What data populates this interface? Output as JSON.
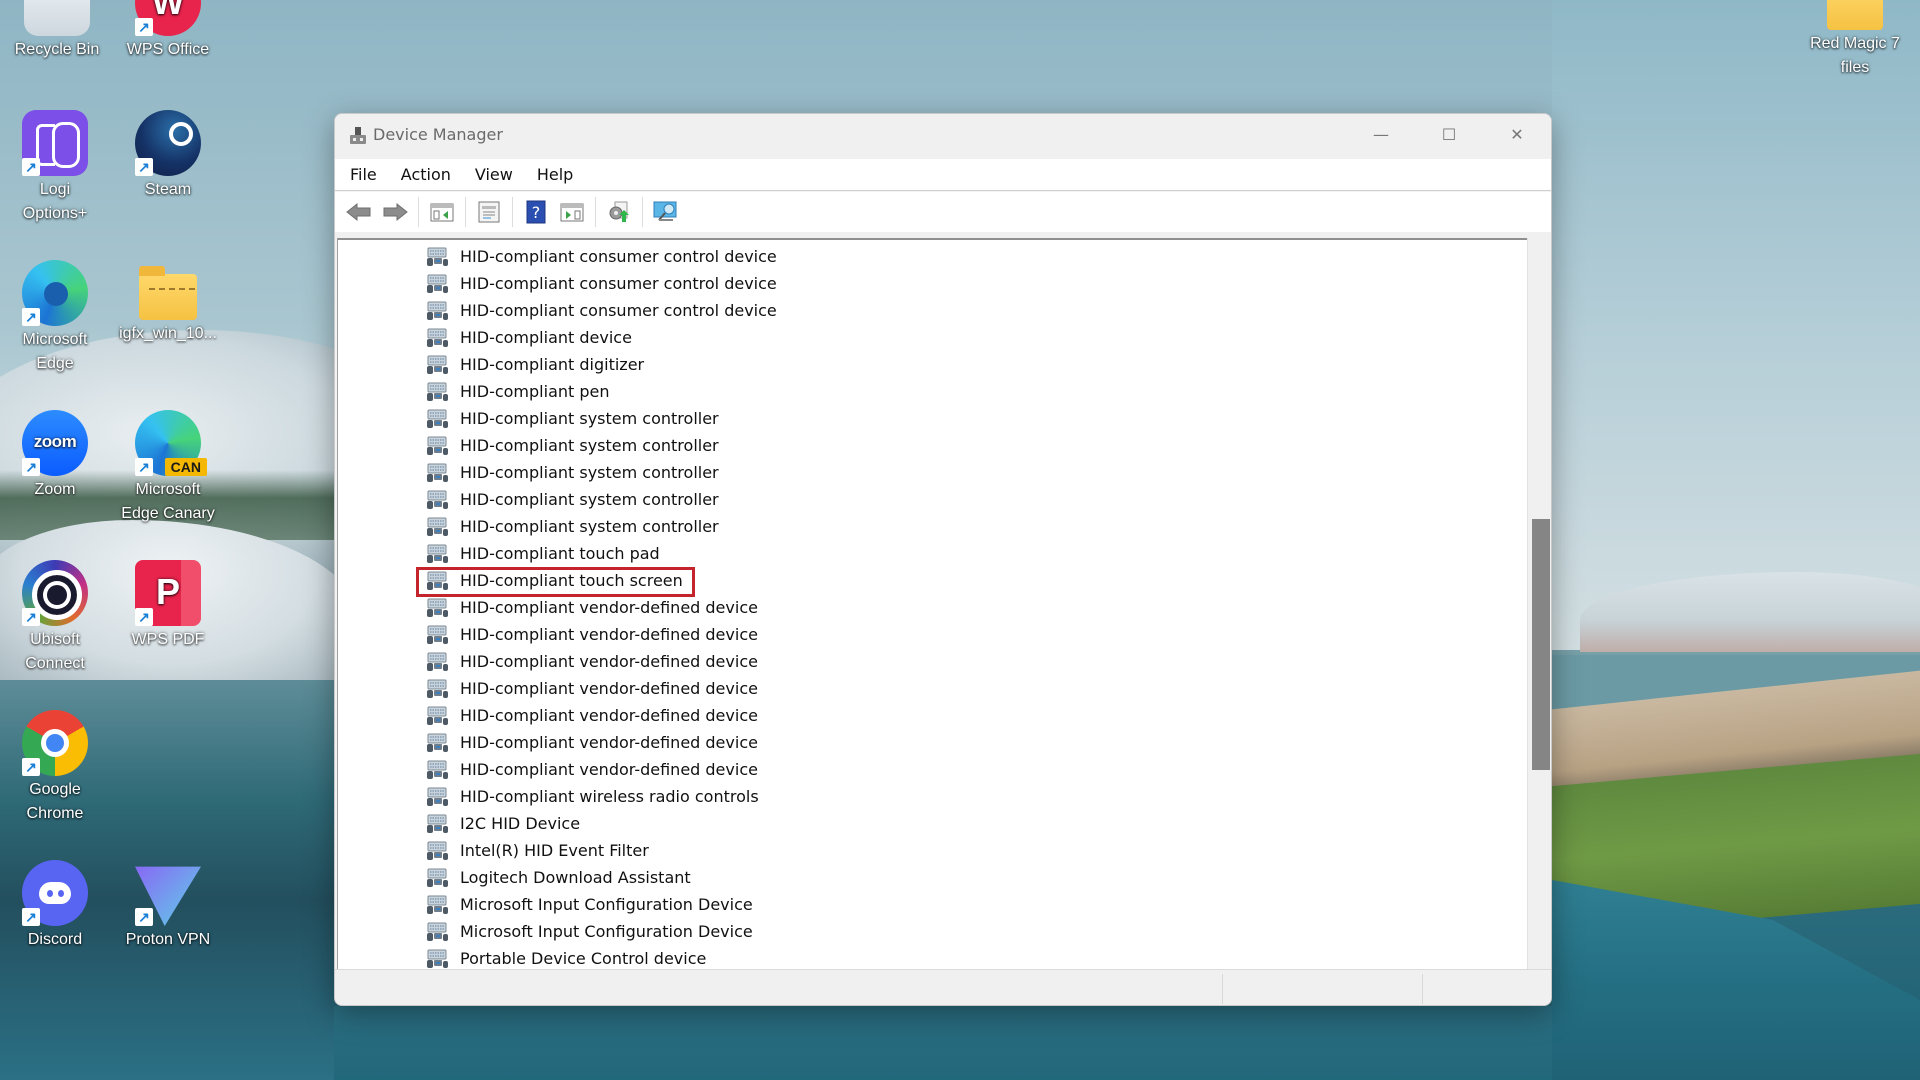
{
  "desktop": {
    "icons": [
      {
        "label": "Recycle Bin",
        "icon": "recycle-bin-icon"
      },
      {
        "label": "WPS Office",
        "icon": "wps-office-icon"
      },
      {
        "label": "Logi Options+",
        "icon": "logi-options-icon"
      },
      {
        "label": "Steam",
        "icon": "steam-icon"
      },
      {
        "label": "Microsoft Edge",
        "icon": "edge-icon"
      },
      {
        "label": "igfx_win_10...",
        "icon": "zip-folder-icon"
      },
      {
        "label": "Zoom",
        "icon": "zoom-icon",
        "glyph": "zoom"
      },
      {
        "label": "Microsoft Edge Canary",
        "icon": "edge-canary-icon",
        "badge": "CAN"
      },
      {
        "label": "Ubisoft Connect",
        "icon": "ubisoft-icon"
      },
      {
        "label": "WPS PDF",
        "icon": "wps-pdf-icon"
      },
      {
        "label": "Google Chrome",
        "icon": "chrome-icon"
      },
      {
        "label": "Discord",
        "icon": "discord-icon"
      },
      {
        "label": "Proton VPN",
        "icon": "proton-vpn-icon"
      },
      {
        "label": "Red Magic 7 files",
        "icon": "folder-icon"
      }
    ],
    "shortcut_glyph": "↗"
  },
  "window": {
    "title": "Device Manager",
    "controls": {
      "minimize": "—",
      "maximize": "☐",
      "close": "✕"
    },
    "menu": [
      "File",
      "Action",
      "View",
      "Help"
    ],
    "toolbar": [
      {
        "name": "back-button",
        "icon": "arrow-left-icon"
      },
      {
        "name": "forward-button",
        "icon": "arrow-right-icon"
      },
      {
        "name": "show-hide-console-tree-button",
        "icon": "console-tree-icon"
      },
      {
        "name": "properties-button",
        "icon": "properties-icon"
      },
      {
        "name": "help-button",
        "icon": "help-icon",
        "glyph": "?"
      },
      {
        "name": "show-hide-action-pane-button",
        "icon": "action-pane-icon"
      },
      {
        "name": "update-driver-button",
        "icon": "update-driver-icon"
      },
      {
        "name": "scan-hardware-button",
        "icon": "monitor-scan-icon"
      }
    ],
    "devices": [
      "HID-compliant consumer control device",
      "HID-compliant consumer control device",
      "HID-compliant consumer control device",
      "HID-compliant device",
      "HID-compliant digitizer",
      "HID-compliant pen",
      "HID-compliant system controller",
      "HID-compliant system controller",
      "HID-compliant system controller",
      "HID-compliant system controller",
      "HID-compliant system controller",
      "HID-compliant touch pad",
      "HID-compliant touch screen",
      "HID-compliant vendor-defined device",
      "HID-compliant vendor-defined device",
      "HID-compliant vendor-defined device",
      "HID-compliant vendor-defined device",
      "HID-compliant vendor-defined device",
      "HID-compliant vendor-defined device",
      "HID-compliant vendor-defined device",
      "HID-compliant wireless radio controls",
      "I2C HID Device",
      "Intel(R) HID Event Filter",
      "Logitech Download Assistant",
      "Microsoft Input Configuration Device",
      "Microsoft Input Configuration Device",
      "Portable Device Control device"
    ],
    "highlighted_device_index": 12,
    "highlight_color": "#c4252c",
    "scroll_position_fraction": 0.45
  }
}
